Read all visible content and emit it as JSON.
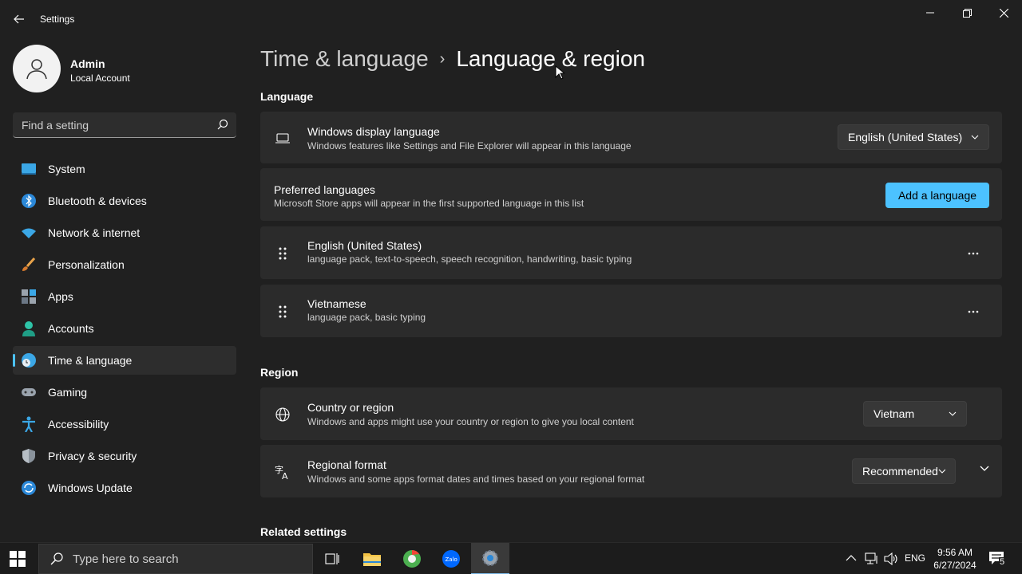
{
  "window": {
    "title": "Settings",
    "back_icon": "arrow-left-icon",
    "controls": [
      "minimize-icon",
      "restore-icon",
      "close-icon"
    ]
  },
  "profile": {
    "name": "Admin",
    "account_type": "Local Account"
  },
  "search": {
    "placeholder": "Find a setting"
  },
  "sidebar": {
    "items": [
      {
        "label": "System",
        "icon": "system-icon",
        "active": false
      },
      {
        "label": "Bluetooth & devices",
        "icon": "bluetooth-icon",
        "active": false
      },
      {
        "label": "Network & internet",
        "icon": "wifi-icon",
        "active": false
      },
      {
        "label": "Personalization",
        "icon": "brush-icon",
        "active": false
      },
      {
        "label": "Apps",
        "icon": "apps-icon",
        "active": false
      },
      {
        "label": "Accounts",
        "icon": "person-icon",
        "active": false
      },
      {
        "label": "Time & language",
        "icon": "clock-globe-icon",
        "active": true
      },
      {
        "label": "Gaming",
        "icon": "gamepad-icon",
        "active": false
      },
      {
        "label": "Accessibility",
        "icon": "accessibility-icon",
        "active": false
      },
      {
        "label": "Privacy & security",
        "icon": "shield-icon",
        "active": false
      },
      {
        "label": "Windows Update",
        "icon": "update-icon",
        "active": false
      }
    ]
  },
  "breadcrumb": {
    "parent": "Time & language",
    "separator": "›",
    "current": "Language & region"
  },
  "language": {
    "section_title": "Language",
    "display_language": {
      "title": "Windows display language",
      "description": "Windows features like Settings and File Explorer will appear in this language",
      "value": "English (United States)"
    },
    "preferred": {
      "title": "Preferred languages",
      "description": "Microsoft Store apps will appear in the first supported language in this list",
      "button": "Add a language"
    },
    "languages": [
      {
        "name": "English (United States)",
        "features": "language pack, text-to-speech, speech recognition, handwriting, basic typing"
      },
      {
        "name": "Vietnamese",
        "features": "language pack, basic typing"
      }
    ]
  },
  "region": {
    "section_title": "Region",
    "country": {
      "title": "Country or region",
      "description": "Windows and apps might use your country or region to give you local content",
      "value": "Vietnam"
    },
    "format": {
      "title": "Regional format",
      "description": "Windows and some apps format dates and times based on your regional format",
      "value": "Recommended"
    }
  },
  "related": {
    "section_title": "Related settings"
  },
  "taskbar": {
    "search_placeholder": "Type here to search",
    "apps": [
      "task-view-icon",
      "file-explorer-icon",
      "browser-icon",
      "zalo-icon",
      "settings-gear-icon"
    ],
    "tray_language": "ENG",
    "time": "9:56 AM",
    "date": "6/27/2024",
    "notification_count": "5"
  },
  "colors": {
    "accent": "#4cc2ff",
    "background": "#202020",
    "card": "#2b2b2b"
  }
}
